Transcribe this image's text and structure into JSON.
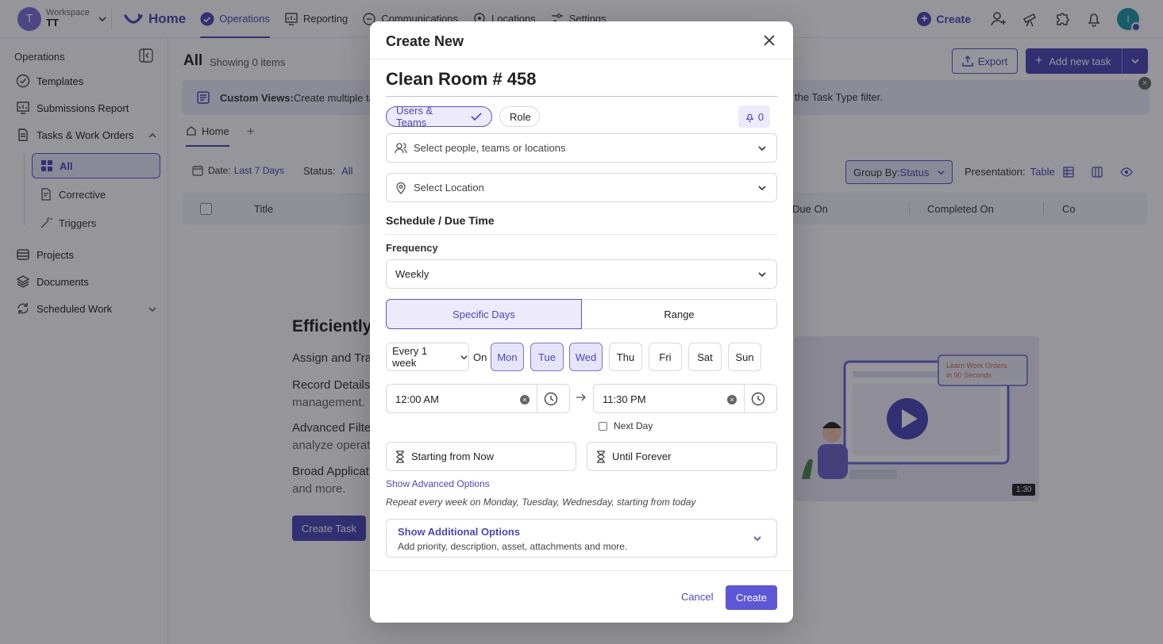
{
  "workspace": {
    "label": "Workspace",
    "name": "TT",
    "avatar_letter": "T"
  },
  "topnav": {
    "home": "Home",
    "operations": "Operations",
    "reporting": "Reporting",
    "communications": "Communications",
    "locations": "Locations",
    "settings": "Settings",
    "create": "Create",
    "user_initial": "I"
  },
  "sidebar": {
    "heading": "Operations",
    "templates": "Templates",
    "submissions_report": "Submissions Report",
    "tasks_work_orders": "Tasks & Work Orders",
    "all": "All",
    "corrective": "Corrective",
    "triggers": "Triggers",
    "projects": "Projects",
    "documents": "Documents",
    "scheduled_work": "Scheduled Work"
  },
  "main": {
    "title": "All",
    "count": "Showing 0 items",
    "export": "Export",
    "add_new_task": "Add new task",
    "banner": {
      "bold": "Custom Views:",
      "text": " Create multiple ta",
      "text_right": "the Task Type filter."
    },
    "tab_home": "Home",
    "tab_add": "+",
    "filter_date_label": "Date:",
    "filter_date_value": "Last 7 Days",
    "filter_status_label": "Status:",
    "filter_status_value": "All",
    "group_by_label": "Group By:",
    "group_by_value": "Status",
    "presentation_label": "Presentation:",
    "presentation_value": "Table",
    "columns": {
      "title": "Title",
      "due_on": "Due On",
      "completed_on": "Completed On",
      "co": "Co"
    },
    "empty": {
      "title": "Efficiently",
      "line1": "Assign and Tra",
      "line2": "Record Details",
      "line2b": "management.",
      "line3": "Advanced Filte",
      "line3b": "analyze operat",
      "line4": "Broad Applicat",
      "line4b": "and more.",
      "button": "Create Task"
    },
    "video": {
      "card_line1": "Learn Work Orders",
      "card_line2": "in 90 Seconds",
      "duration": "1:30"
    }
  },
  "modal": {
    "title": "Create New",
    "task_name": "Clean Room # 458",
    "assign_users_teams": "Users & Teams",
    "assign_role": "Role",
    "notify_count": "0",
    "people_placeholder": "Select people, teams or locations",
    "location_placeholder": "Select Location",
    "schedule_title": "Schedule / Due Time",
    "frequency_label": "Frequency",
    "frequency_value": "Weekly",
    "mode_specific_days": "Specific Days",
    "mode_range": "Range",
    "every": "Every 1 week",
    "on_label": "On",
    "days": [
      "Mon",
      "Tue",
      "Wed",
      "Thu",
      "Fri",
      "Sat",
      "Sun"
    ],
    "start_time": "12:00 AM",
    "end_time": "11:30 PM",
    "next_day": "Next Day",
    "starting": "Starting from Now",
    "until": "Until Forever",
    "show_advanced": "Show Advanced Options",
    "summary": "Repeat every week on Monday, Tuesday, Wednesday, starting from today",
    "additional_title": "Show Additional Options",
    "additional_sub": "Add priority, description, asset, attachments and more.",
    "cancel": "Cancel",
    "create": "Create"
  },
  "colors": {
    "accent": "#4b47b8",
    "accent_light": "#eceafb",
    "overlay": "#14141e"
  },
  "icons": [
    "chevron-down-icon",
    "home-logo-icon",
    "operations-check-icon",
    "reporting-icon",
    "communications-icon",
    "locations-icon",
    "settings-icon",
    "plus-icon",
    "add-user-icon",
    "telescope-icon",
    "puzzle-icon",
    "bell-icon",
    "sidebar-collapse-icon",
    "templates-icon",
    "report-icon",
    "tasks-icon",
    "grid-icon",
    "corrective-icon",
    "wand-icon",
    "projects-icon",
    "documents-icon",
    "scheduled-icon",
    "export-icon",
    "calendar-icon",
    "table-icon",
    "columns-icon",
    "eye-icon",
    "close-icon",
    "check-icon",
    "users-icon",
    "location-pin-icon",
    "clock-icon",
    "arrow-right-icon",
    "hourglass-icon",
    "play-icon"
  ]
}
